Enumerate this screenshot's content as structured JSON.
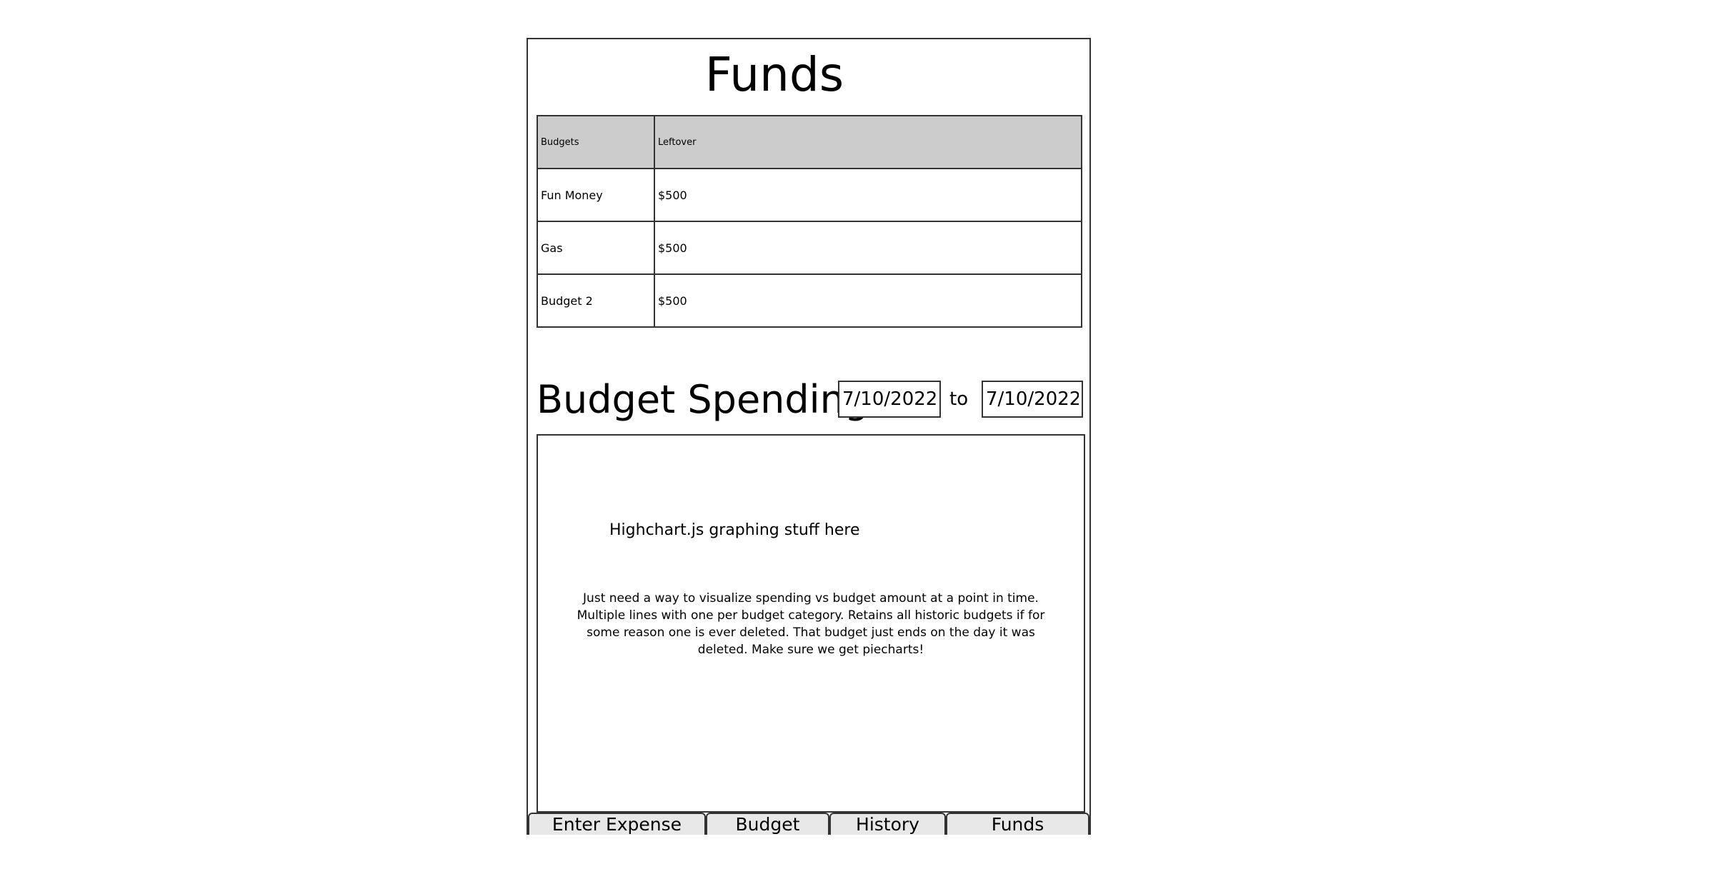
{
  "page": {
    "title": "Funds"
  },
  "funds_table": {
    "headers": [
      "Budgets",
      "Leftover"
    ],
    "rows": [
      [
        "Fun Money",
        "$500"
      ],
      [
        "Gas",
        "$500"
      ],
      [
        "Budget 2",
        "$500"
      ]
    ]
  },
  "budget_spending": {
    "heading": "Budget Spending",
    "date_from": "7/10/2022",
    "to_label": "to",
    "date_to": "7/10/2022"
  },
  "chart_area": {
    "placeholder": "Highchart.js graphing stuff here",
    "note": "Just need a way to visualize spending vs budget amount at a point in time. Multiple lines with one per budget category. Retains all historic budgets if for some reason one is ever deleted. That budget just ends on the day it was deleted. Make sure we get piecharts!"
  },
  "tabs": [
    {
      "label": "Enter Expense"
    },
    {
      "label": "Budget"
    },
    {
      "label": "History"
    },
    {
      "label": "Funds"
    }
  ]
}
